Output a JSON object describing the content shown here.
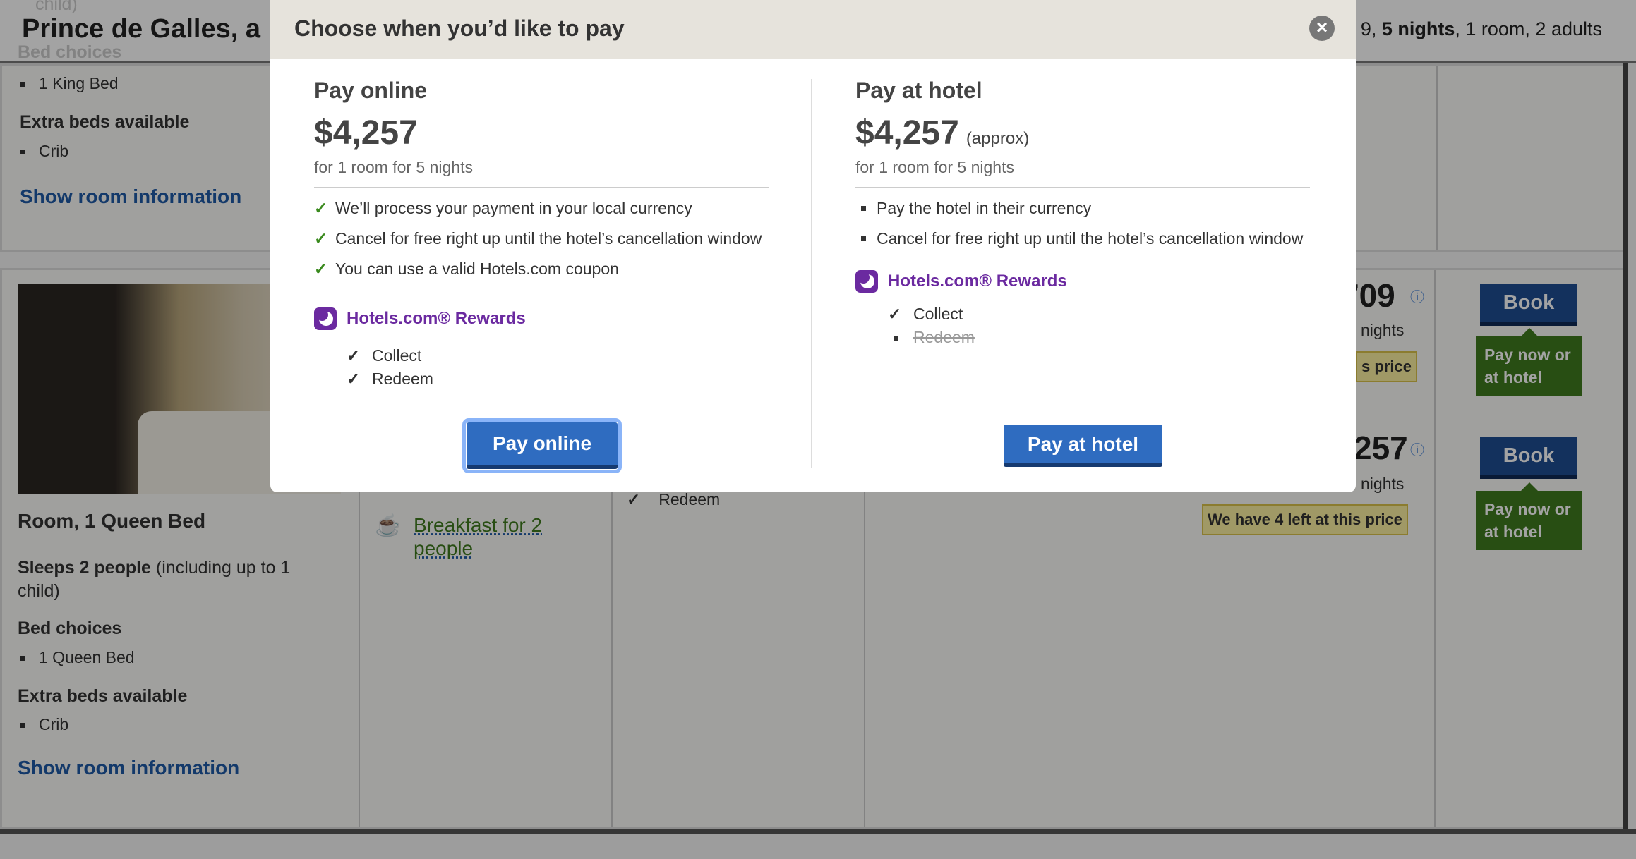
{
  "background": {
    "hotel_title": "Prince de Galles, a",
    "faded_top": "child)",
    "faded_bed_choices": "Bed choices",
    "stay_summary_pre": "9, ",
    "stay_summary_bold": "5 nights",
    "stay_summary_post": ", 1 room, 2 adults",
    "room1": {
      "bed": "1 King Bed",
      "extra_beds_heading": "Extra beds available",
      "extra_bed": "Crib",
      "show_info": "Show room information"
    },
    "room2": {
      "name": "Room, 1 Queen Bed",
      "sleeps_bold": "Sleeps 2 people",
      "sleeps_rest": " (including up to 1 child)",
      "bed_choices_heading": "Bed choices",
      "bed": "1 Queen Bed",
      "extra_beds_heading": "Extra beds available",
      "extra_bed": "Crib",
      "show_info": "Show room information",
      "breakfast": "Breakfast for 2 people",
      "redeem": "Redeem"
    },
    "rates": [
      {
        "price_partial": "709",
        "nights": "nights",
        "tag": "s price",
        "book": "Book",
        "pay_option": "Pay now or at hotel"
      },
      {
        "price_partial": "257",
        "nights": "nights",
        "tag": "We have 4 left at this price",
        "book": "Book",
        "pay_option": "Pay now or at hotel"
      }
    ]
  },
  "modal": {
    "title": "Choose when you’d like to pay",
    "close_icon": "close-circle-icon",
    "pay_online": {
      "heading": "Pay online",
      "price": "$4,257",
      "subtitle": "for 1 room for 5 nights",
      "benefits": [
        "We’ll process your payment in your local currency",
        "Cancel for free right up until the hotel’s cancellation window",
        "You can use a valid Hotels.com coupon"
      ],
      "rewards": "Hotels.com® Rewards",
      "rewards_items": [
        {
          "label": "Collect",
          "available": true
        },
        {
          "label": "Redeem",
          "available": true
        }
      ],
      "button": "Pay online"
    },
    "pay_at_hotel": {
      "heading": "Pay at hotel",
      "price": "$4,257",
      "approx": "(approx)",
      "subtitle": "for 1 room for 5 nights",
      "benefits": [
        "Pay the hotel in their currency",
        "Cancel for free right up until the hotel’s cancellation window"
      ],
      "rewards": "Hotels.com® Rewards",
      "rewards_items": [
        {
          "label": "Collect",
          "available": true
        },
        {
          "label": "Redeem",
          "available": false
        }
      ],
      "button": "Pay at hotel"
    }
  },
  "colors": {
    "primary_button": "#2f6cc0",
    "rewards_purple": "#6b2aa0",
    "check_green": "#3a8a1e",
    "book_blue": "#1f4e92",
    "pay_option_green": "#3f7a1e"
  }
}
